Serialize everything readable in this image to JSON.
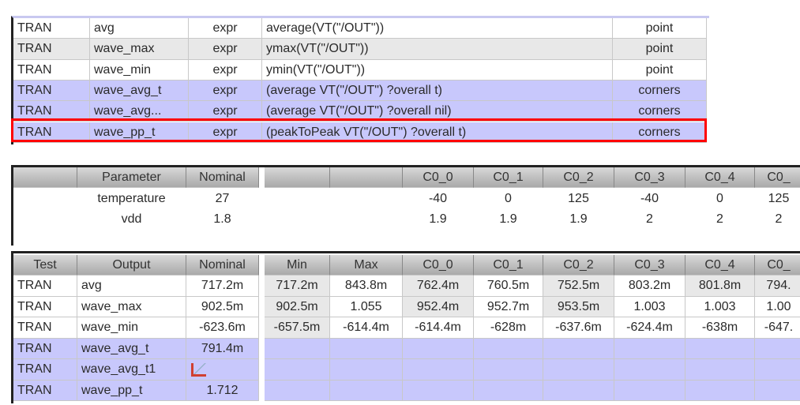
{
  "outputs_table": {
    "rows": [
      {
        "test": "TRAN",
        "name": "avg",
        "type": "expr",
        "expression": "average(VT(\"/OUT\"))",
        "eval": "point",
        "style": "white"
      },
      {
        "test": "TRAN",
        "name": "wave_max",
        "type": "expr",
        "expression": "ymax(VT(\"/OUT\"))",
        "eval": "point",
        "style": "gray"
      },
      {
        "test": "TRAN",
        "name": "wave_min",
        "type": "expr",
        "expression": "ymin(VT(\"/OUT\"))",
        "eval": "point",
        "style": "white"
      },
      {
        "test": "TRAN",
        "name": "wave_avg_t",
        "type": "expr",
        "expression": "(average VT(\"/OUT\") ?overall t)",
        "eval": "corners",
        "style": "blue"
      },
      {
        "test": "TRAN",
        "name": "wave_avg...",
        "type": "expr",
        "expression": "(average VT(\"/OUT\") ?overall nil)",
        "eval": "corners",
        "style": "blue"
      },
      {
        "test": "TRAN",
        "name": "wave_pp_t",
        "type": "expr",
        "expression": "(peakToPeak VT(\"/OUT\") ?overall t)",
        "eval": "corners",
        "style": "blue"
      }
    ],
    "selected_row": 5
  },
  "params_table": {
    "headers": [
      "",
      "Parameter",
      "Nominal",
      "",
      "",
      "C0_0",
      "C0_1",
      "C0_2",
      "C0_3",
      "C0_4",
      "C0_"
    ],
    "rows": [
      [
        "",
        "temperature",
        "27",
        "",
        "",
        "-40",
        "0",
        "125",
        "-40",
        "0",
        "125"
      ],
      [
        "",
        "vdd",
        "1.8",
        "",
        "",
        "1.9",
        "1.9",
        "1.9",
        "2",
        "2",
        "2"
      ]
    ]
  },
  "results_table": {
    "headers": [
      "Test",
      "Output",
      "Nominal",
      "Min",
      "Max",
      "C0_0",
      "C0_1",
      "C0_2",
      "C0_3",
      "C0_4",
      "C0_"
    ],
    "rows": [
      [
        "TRAN",
        "avg",
        "717.2m",
        "717.2m",
        "843.8m",
        "762.4m",
        "760.5m",
        "752.5m",
        "803.2m",
        "801.8m",
        "794."
      ],
      [
        "TRAN",
        "wave_max",
        "902.5m",
        "902.5m",
        "1.055",
        "952.4m",
        "952.7m",
        "953.5m",
        "1.003",
        "1.003",
        "1.00"
      ],
      [
        "TRAN",
        "wave_min",
        "-623.6m",
        "-657.5m",
        "-614.4m",
        "-614.4m",
        "-628m",
        "-637.6m",
        "-624.4m",
        "-638m",
        "-647."
      ],
      [
        "TRAN",
        "wave_avg_t",
        "791.4m",
        "",
        "",
        "",
        "",
        "",
        "",
        "",
        "",
        ""
      ],
      [
        "TRAN",
        "wave_avg_t1",
        "",
        "",
        "",
        "",
        "",
        "",
        "",
        "",
        "",
        ""
      ],
      [
        "TRAN",
        "wave_pp_t",
        "1.712",
        "",
        "",
        "",
        "",
        "",
        "",
        "",
        "",
        ""
      ]
    ],
    "waveform_icon_row": 4
  },
  "colors": {
    "selection": "#ff0000",
    "corner_row": "#c8c8fc",
    "alt_row": "#e8e8e8"
  }
}
